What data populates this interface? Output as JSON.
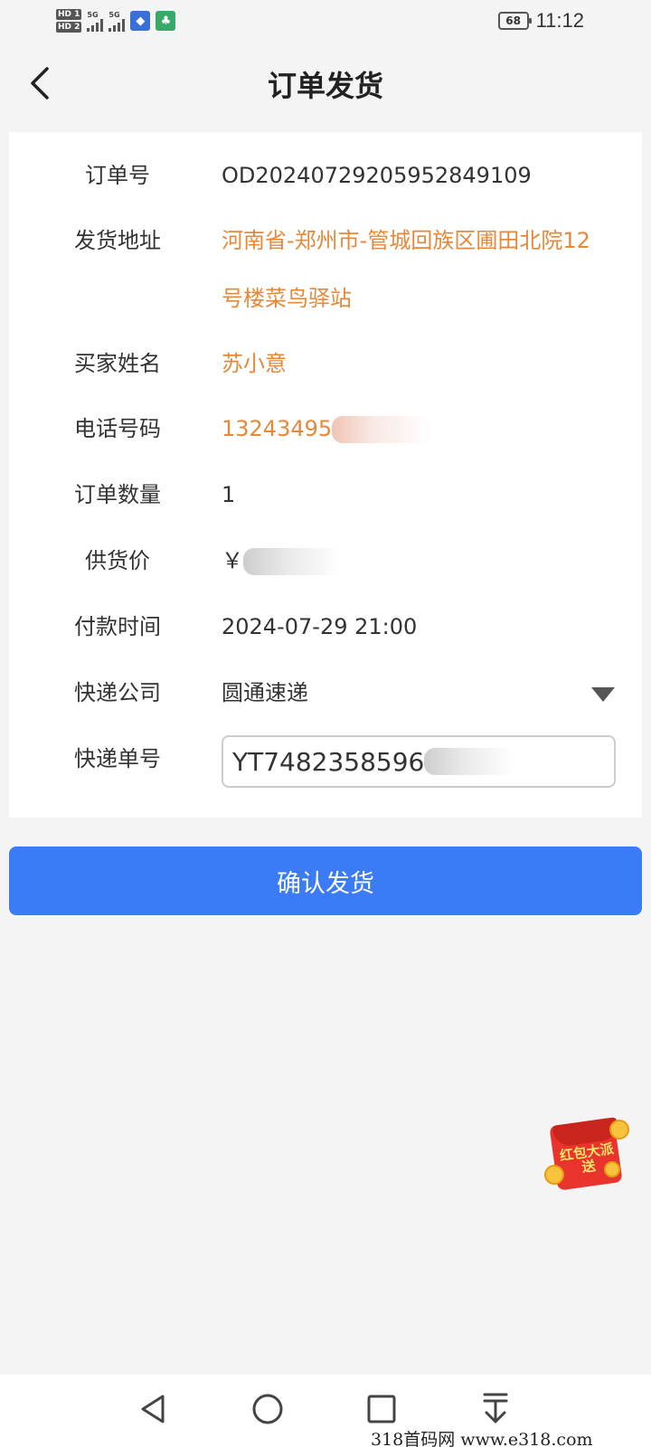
{
  "status_bar": {
    "hd1": "HD 1",
    "hd2": "HD 2",
    "signal1": "5G",
    "signal2": "5G",
    "battery": "68",
    "time": "11:12"
  },
  "header": {
    "title": "订单发货",
    "back_icon": "chevron-left-icon"
  },
  "order": {
    "fields": [
      {
        "label": "订单号",
        "value": "OD20240729205952849109"
      },
      {
        "label": "发货地址",
        "value": "河南省-郑州市-管城回族区圃田北院12号楼菜鸟驿站"
      },
      {
        "label": "买家姓名",
        "value": "苏小意"
      },
      {
        "label": "电话号码",
        "value": "13243495"
      },
      {
        "label": "订单数量",
        "value": "1"
      },
      {
        "label": "供货价",
        "value": "￥"
      },
      {
        "label": "付款时间",
        "value": "2024-07-29 21:00"
      },
      {
        "label": "快递公司",
        "value": "圆通速递"
      },
      {
        "label": "快递单号",
        "value": "YT7482358596"
      }
    ]
  },
  "actions": {
    "confirm_label": "确认发货"
  },
  "promo": {
    "red_packet_text": "红包大派送"
  },
  "nav": {
    "icons": [
      "back-triangle-icon",
      "home-circle-icon",
      "recents-square-icon",
      "notification-pull-icon"
    ]
  },
  "watermark": "318首码网 www.e318.com",
  "colors": {
    "accent": "#3b7cf6",
    "highlight": "#e6883a",
    "background": "#f4f4f5"
  }
}
